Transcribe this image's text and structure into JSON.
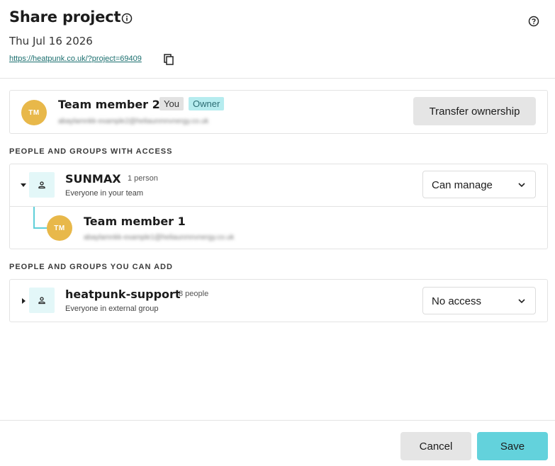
{
  "header": {
    "title": "Share project",
    "date": "Thu Jul 16 2026",
    "link": "https://heatpunk.co.uk/?project=69409"
  },
  "owner": {
    "initials": "TM",
    "name": "Team member 2",
    "badge_you": "You",
    "badge_owner": "Owner",
    "email": "abaylamnkk-example2@heliaunmnvnergy.co.uk",
    "transfer_label": "Transfer ownership"
  },
  "sections": {
    "with_access": "PEOPLE AND GROUPS WITH ACCESS",
    "can_add": "PEOPLE AND GROUPS YOU CAN ADD"
  },
  "groups": [
    {
      "name": "SUNMAX",
      "count": "1 person",
      "subtitle": "Everyone in your team",
      "permission": "Can manage",
      "expanded": true,
      "members": [
        {
          "initials": "TM",
          "name": "Team member 1",
          "email": "abaylamnkk-example1@heliaunmnvnergy.co.uk"
        }
      ]
    },
    {
      "name": "heatpunk-support",
      "count": "8 people",
      "subtitle": "Everyone in external group",
      "permission": "No access",
      "expanded": false
    }
  ],
  "footer": {
    "cancel_label": "Cancel",
    "save_label": "Save"
  },
  "colors": {
    "avatar": "#e8b84a",
    "accent": "#63d2dc",
    "owner_badge_bg": "#b6ecef",
    "group_icon_bg": "#e3f7f8"
  }
}
